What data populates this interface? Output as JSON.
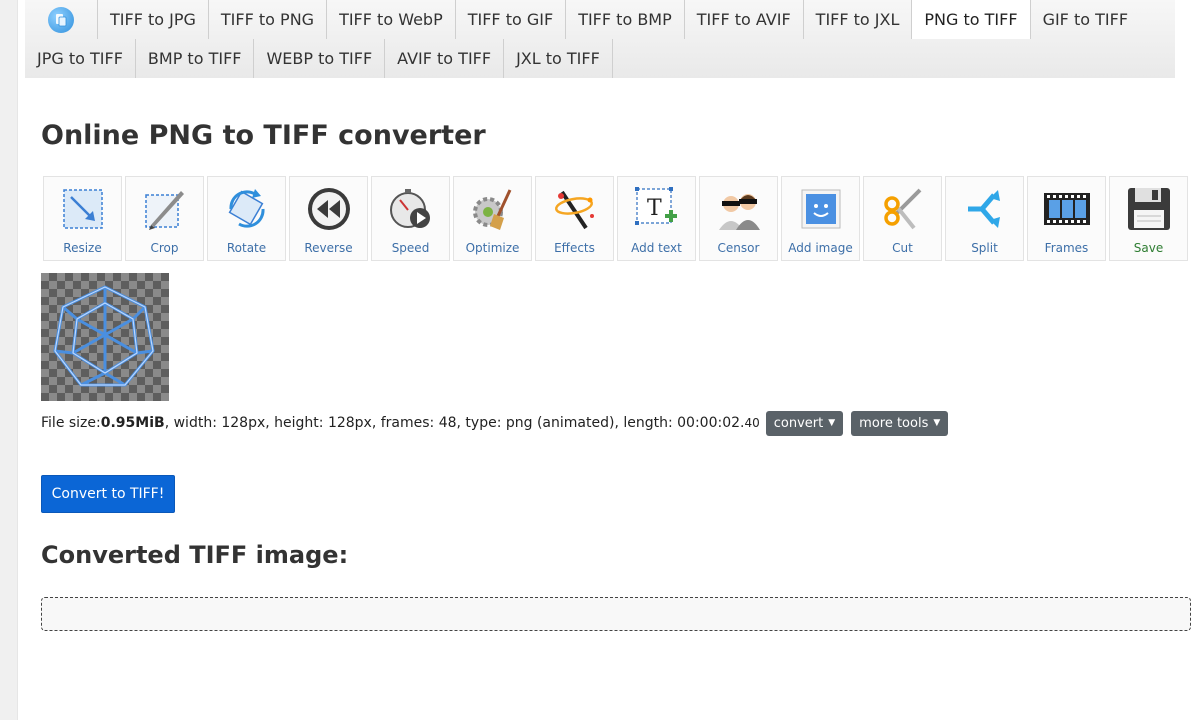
{
  "tabs": {
    "row1": [
      "TIFF to JPG",
      "TIFF to PNG",
      "TIFF to WebP",
      "TIFF to GIF",
      "TIFF to BMP",
      "TIFF to AVIF",
      "TIFF to JXL",
      "PNG to TIFF",
      "GIF to TIFF"
    ],
    "row2": [
      "JPG to TIFF",
      "BMP to TIFF",
      "WEBP to TIFF",
      "AVIF to TIFF",
      "JXL to TIFF"
    ],
    "active": "PNG to TIFF"
  },
  "page_title": "Online PNG to TIFF converter",
  "toolbar": [
    {
      "label": "Resize",
      "icon": "resize-icon"
    },
    {
      "label": "Crop",
      "icon": "crop-icon"
    },
    {
      "label": "Rotate",
      "icon": "rotate-icon"
    },
    {
      "label": "Reverse",
      "icon": "reverse-icon"
    },
    {
      "label": "Speed",
      "icon": "speed-icon"
    },
    {
      "label": "Optimize",
      "icon": "optimize-icon"
    },
    {
      "label": "Effects",
      "icon": "effects-icon"
    },
    {
      "label": "Add text",
      "icon": "add-text-icon"
    },
    {
      "label": "Censor",
      "icon": "censor-icon"
    },
    {
      "label": "Add image",
      "icon": "add-image-icon"
    },
    {
      "label": "Cut",
      "icon": "cut-icon"
    },
    {
      "label": "Split",
      "icon": "split-icon"
    },
    {
      "label": "Frames",
      "icon": "frames-icon"
    },
    {
      "label": "Save",
      "icon": "save-icon"
    }
  ],
  "file_info": {
    "size_label": "File size: ",
    "size_value": "0.95MiB",
    "details": ", width: 128px, height: 128px, frames: 48, type: png (animated), length: 00:00:02.",
    "length_fraction": "40",
    "convert_menu": "convert",
    "more_tools_menu": "more tools"
  },
  "convert_button": "Convert to TIFF!",
  "output_heading": "Converted TIFF image:",
  "colors": {
    "primary": "#0b66d6",
    "dropdown": "#5a6268",
    "tool_label": "#3d6fa8",
    "save_label": "#2e7d32"
  }
}
